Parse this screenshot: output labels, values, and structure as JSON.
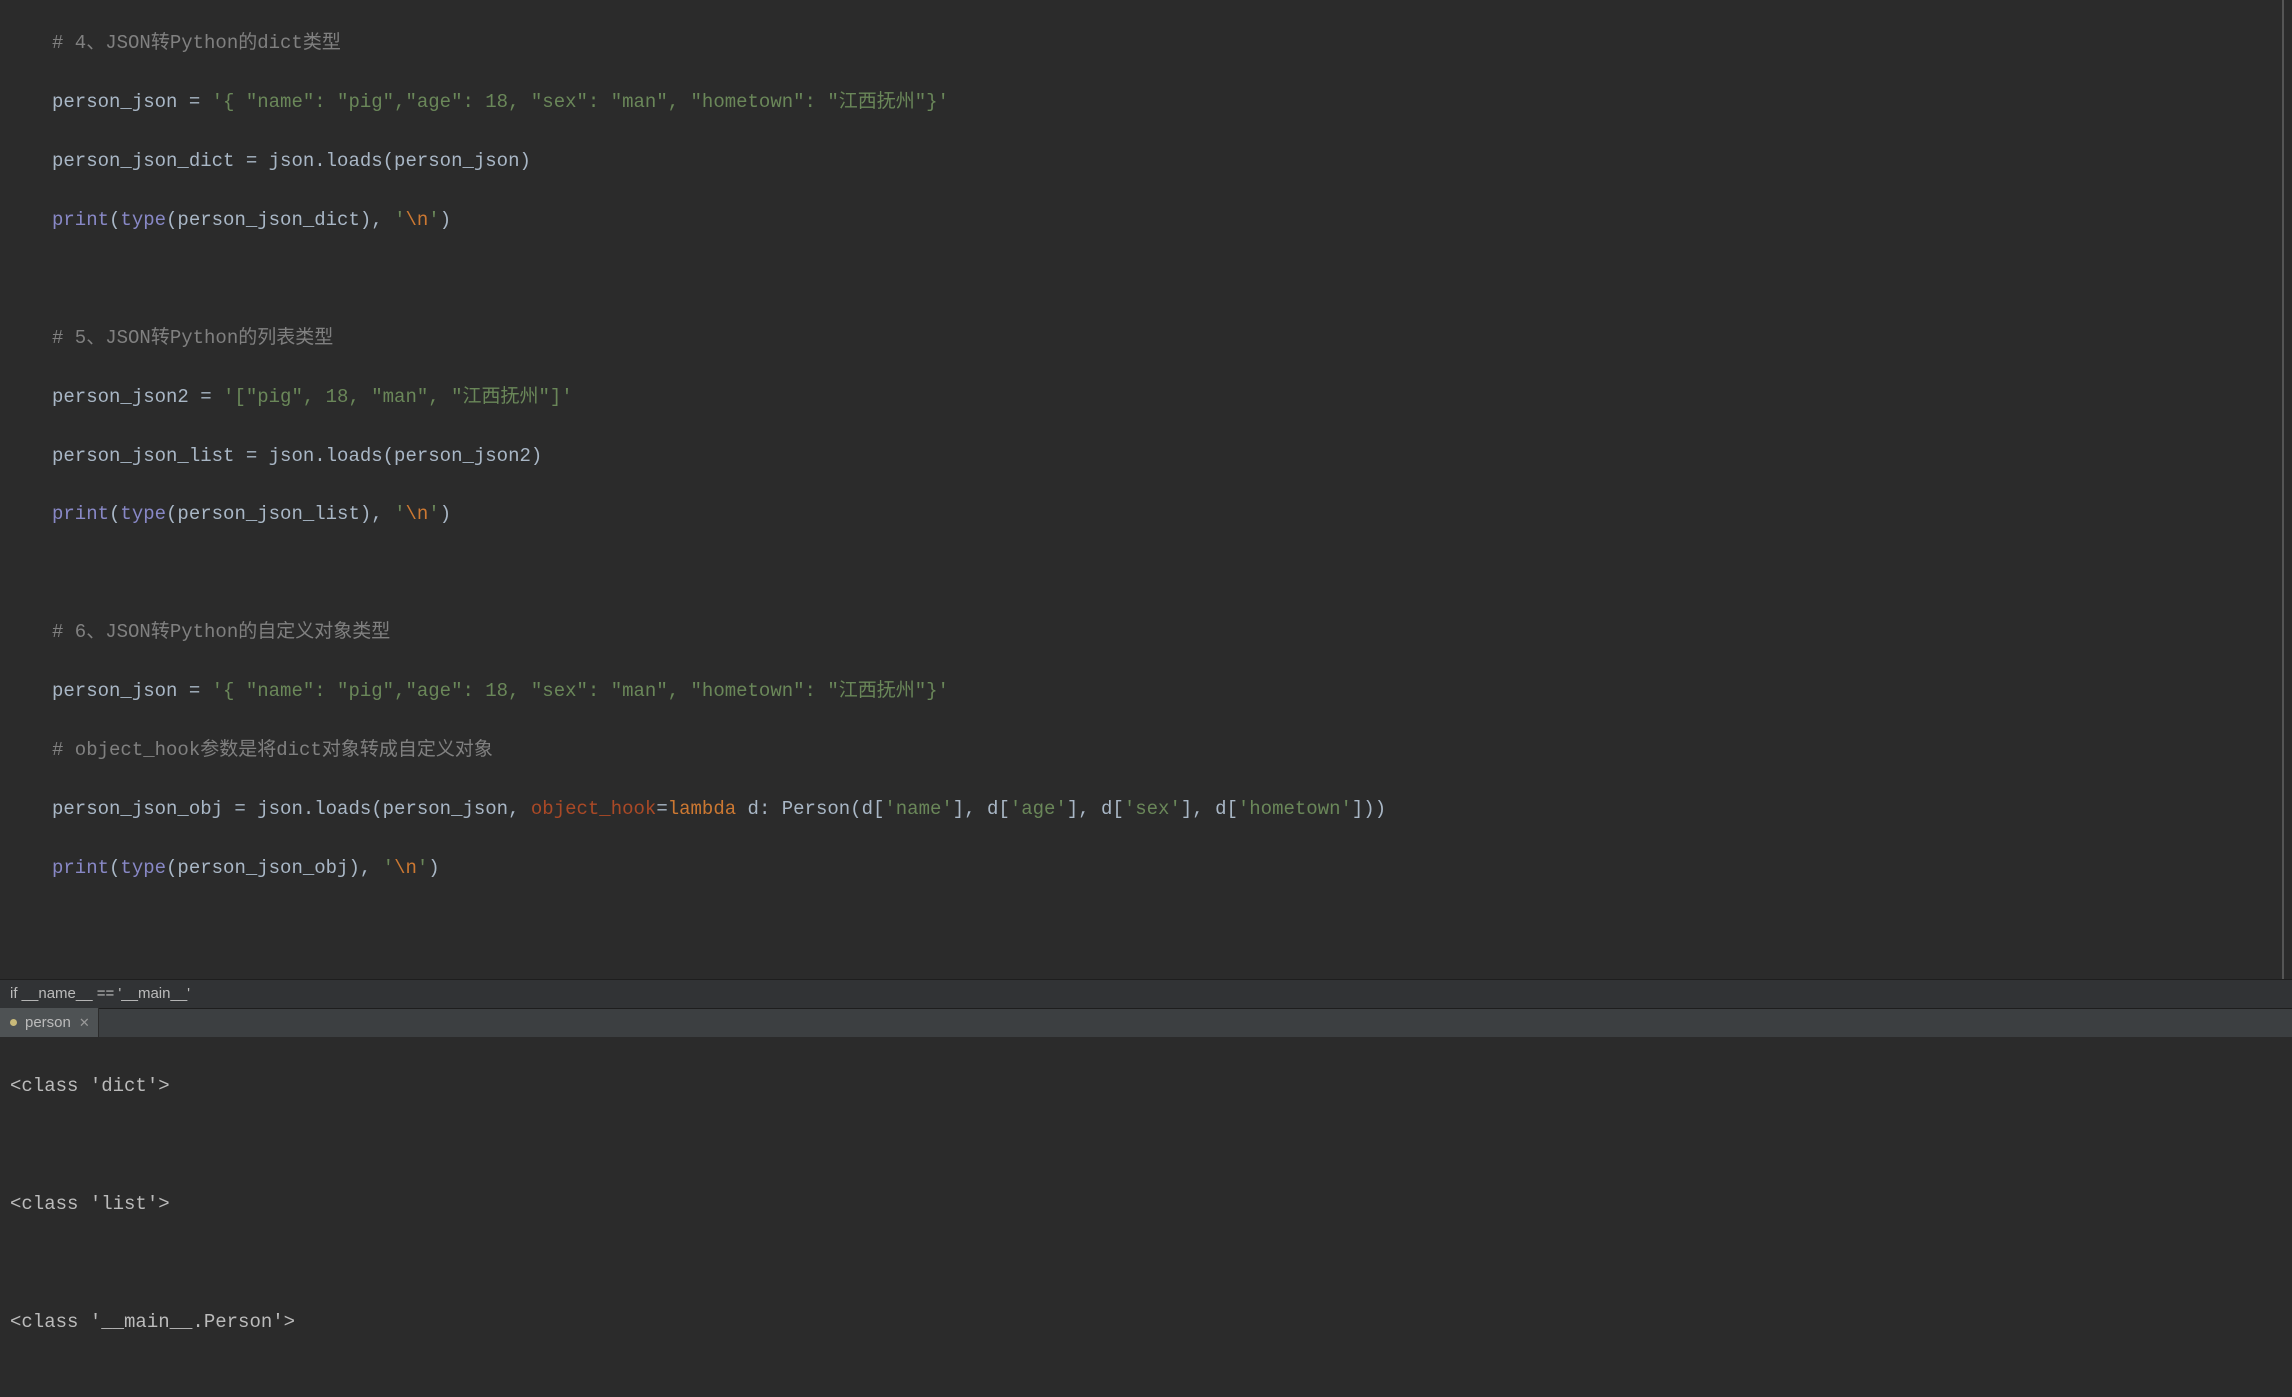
{
  "code": {
    "l01": "# 4、JSON转Python的dict类型",
    "l02_a": "person_json = ",
    "l02_b": "'{ \"name\": \"pig\",\"age\": 18, \"sex\": \"man\", \"hometown\": \"江西抚州\"}'",
    "l03": "person_json_dict = json.loads(person_json)",
    "l04_print": "print",
    "l04_mid1": "(",
    "l04_type": "type",
    "l04_mid2": "(person_json_dict), ",
    "l04_str": "'",
    "l04_esc": "\\n",
    "l04_end": "'",
    "l04_close": ")",
    "l06": "# 5、JSON转Python的列表类型",
    "l07_a": "person_json2 = ",
    "l07_b": "'[\"pig\", 18, \"man\", \"江西抚州\"]'",
    "l08": "person_json_list = json.loads(person_json2)",
    "l09_mid2": "(person_json_list), ",
    "l11": "# 6、JSON转Python的自定义对象类型",
    "l12_a": "person_json = ",
    "l12_b": "'{ \"name\": \"pig\",\"age\": 18, \"sex\": \"man\", \"hometown\": \"江西抚州\"}'",
    "l13": "# object_hook参数是将dict对象转成自定义对象",
    "l14_a": "person_json_obj = json.loads(person_json, ",
    "l14_kw": "object_hook",
    "l14_eq": "=",
    "l14_lambda": "lambda ",
    "l14_body1": "d: Person(d[",
    "l14_s1": "'name'",
    "l14_body2": "], d[",
    "l14_s2": "'age'",
    "l14_body3": "], d[",
    "l14_s3": "'sex'",
    "l14_body4": "], d[",
    "l14_s4": "'hometown'",
    "l14_body5": "]))",
    "l15_mid2": "(person_json_obj), "
  },
  "breadcrumb": "if __name__ == '__main__'",
  "tabs": {
    "active": "person"
  },
  "console": {
    "line1": "<class 'dict'>",
    "line2": "<class 'list'>",
    "line3": "<class '__main__.Person'>"
  }
}
